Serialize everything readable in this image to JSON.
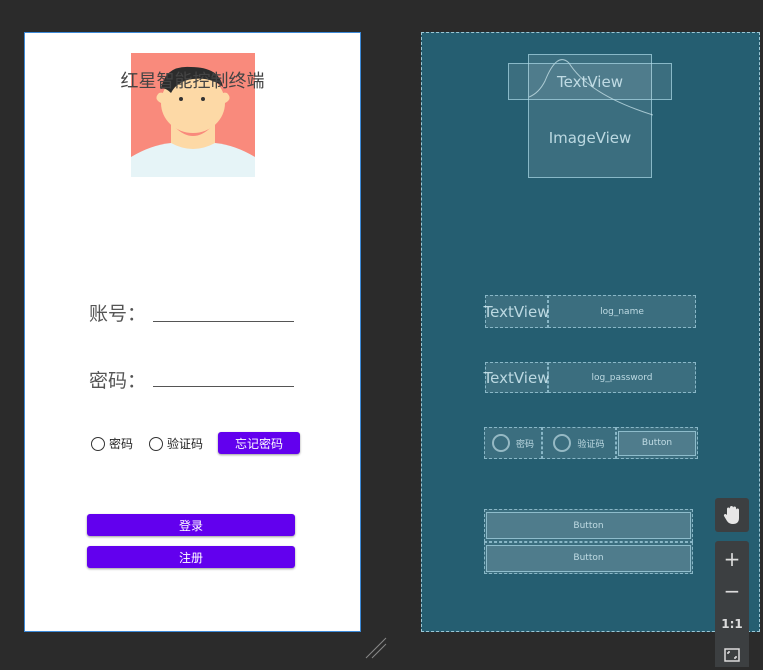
{
  "design": {
    "title": "红星智能控制终端",
    "account_label": "账号：",
    "password_label": "密码：",
    "radio_password": "密码",
    "radio_code": "验证码",
    "forgot_button": "忘记密码",
    "login_button": "登录",
    "register_button": "注册"
  },
  "blueprint": {
    "title_view": "TextView",
    "image_view": "ImageView",
    "account_label_view": "TextView",
    "account_input": "log_name",
    "password_label_view": "TextView",
    "password_input": "log_password",
    "radio_password": "密码",
    "radio_code": "验证码",
    "forgot_button": "Button",
    "login_button": "Button",
    "register_button": "Button"
  },
  "toolbar": {
    "zoom_in": "+",
    "zoom_out": "−",
    "actual_size": "1:1"
  },
  "colors": {
    "accent": "#6200ee",
    "blueprint_bg": "#255e71",
    "avatar_bg": "#f98a7c"
  }
}
